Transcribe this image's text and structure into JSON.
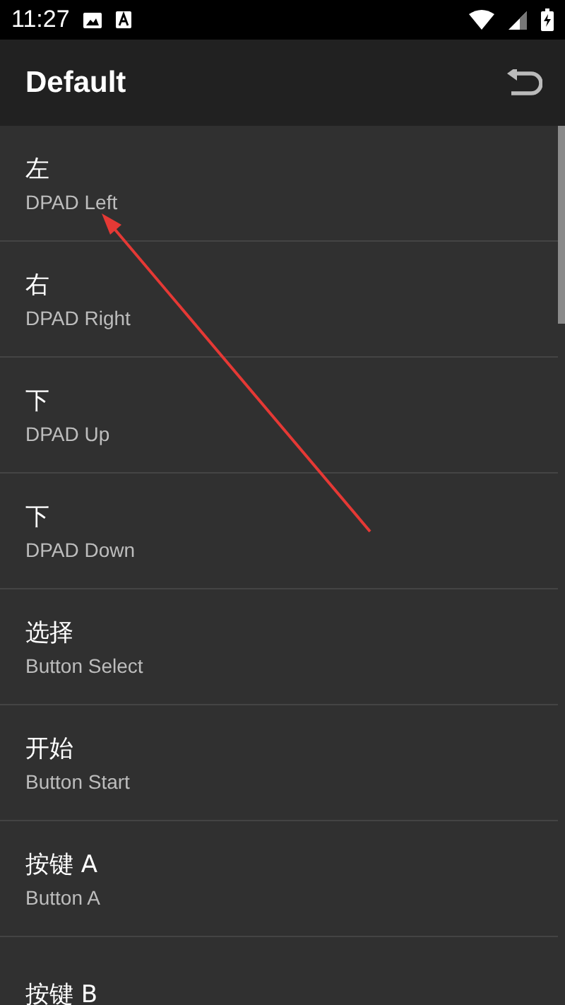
{
  "status_bar": {
    "time": "11:27"
  },
  "app_bar": {
    "title": "Default"
  },
  "items": [
    {
      "title": "左",
      "subtitle": "DPAD Left"
    },
    {
      "title": "右",
      "subtitle": "DPAD Right"
    },
    {
      "title": "下",
      "subtitle": "DPAD Up"
    },
    {
      "title": "下",
      "subtitle": "DPAD Down"
    },
    {
      "title": "选择",
      "subtitle": "Button Select"
    },
    {
      "title": "开始",
      "subtitle": "Button Start"
    },
    {
      "title": "按键 A",
      "subtitle": "Button A"
    },
    {
      "title": "按键 B"
    }
  ]
}
